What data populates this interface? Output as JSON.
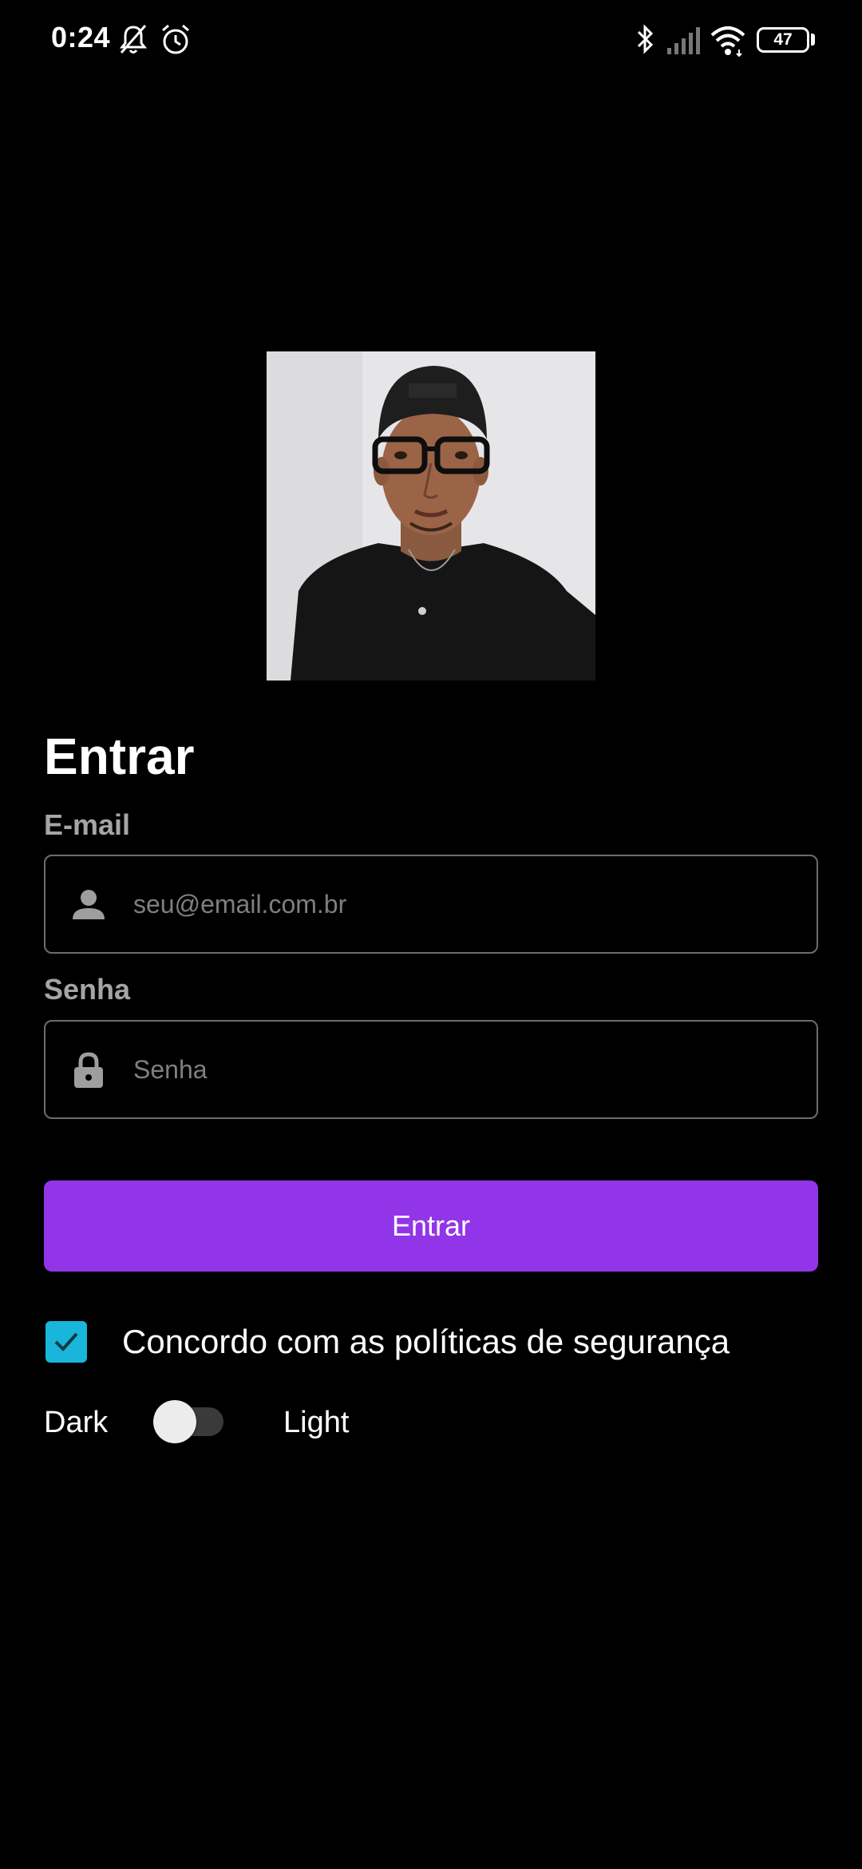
{
  "status_bar": {
    "time": "0:24",
    "battery_level": "47",
    "icons": [
      "mute-icon",
      "alarm-icon",
      "bluetooth-icon",
      "signal-icon",
      "wifi-icon",
      "battery-icon"
    ]
  },
  "profile": {
    "photo_description": "profile-photo"
  },
  "form": {
    "title": "Entrar",
    "email_label": "E-mail",
    "email_placeholder": "seu@email.com.br",
    "email_value": "",
    "password_label": "Senha",
    "password_placeholder": "Senha",
    "password_value": "",
    "submit_label": "Entrar",
    "agree_label": "Concordo com as políticas de segurança",
    "agree_checked": true
  },
  "theme": {
    "dark_label": "Dark",
    "light_label": "Light",
    "is_light": false
  },
  "colors": {
    "background": "#000000",
    "accent": "#9235e8",
    "checkbox": "#1ab5db",
    "label": "#a5a5a5",
    "placeholder": "#7f7f7f"
  }
}
